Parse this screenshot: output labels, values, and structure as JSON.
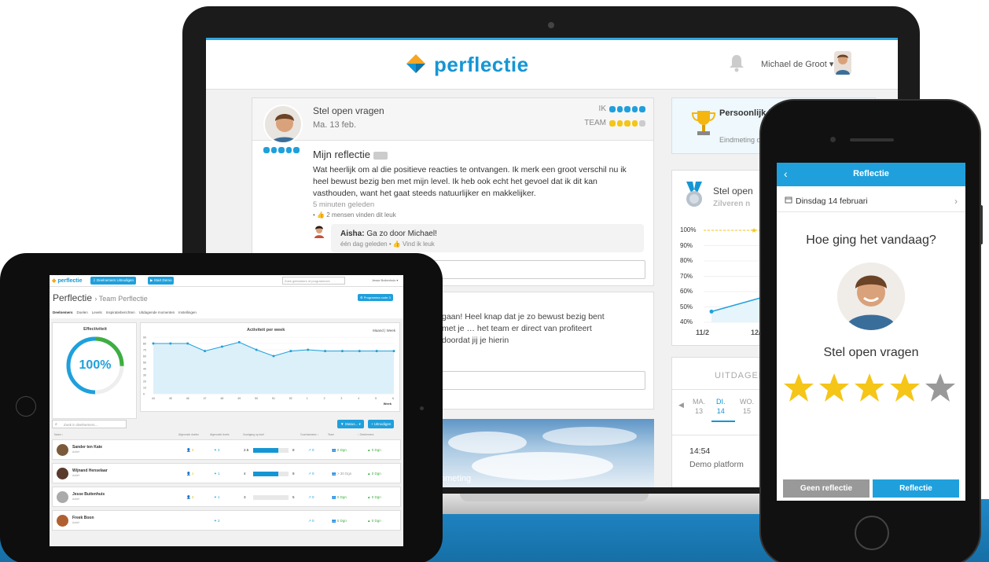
{
  "laptop": {
    "brand": "perflectie",
    "user_name": "Michael de Groot ▾",
    "post": {
      "title": "Stel open vragen",
      "date": "Ma. 13 feb.",
      "ik_label": "IK",
      "team_label": "TEAM",
      "heading": "Mijn reflectie",
      "text": "Wat heerlijk om al die positieve reacties te ontvangen. Ik merk een groot verschil nu ik heel bewust bezig ben met mijn level. Ik heb ook echt het gevoel dat ik dit kan vasthouden, want het gaat steeds natuurlijker en makkelijker.",
      "time": "5 minuten geleden",
      "likes": "• 👍 2 mensen vinden dit leuk",
      "comment_author": "Aisha:",
      "comment_text": " Ga zo door Michael!",
      "comment_meta": "één dag geleden • 👍 Vind ik leuk"
    },
    "partial_text": "gaan! Heel knap dat je zo bewust bezig bent met je … het team er direct van profiteert doordat jij je hierin",
    "photo_caption": "nmeting",
    "side1": {
      "title": "Persoonlijk leiderschap",
      "sub": "Eindmeting ov"
    },
    "side2": {
      "title": "Stel open",
      "subtitle": "Zilveren n",
      "chart_data": {
        "type": "line",
        "x": [
          "11/2",
          "12/"
        ],
        "y_ticks": [
          "100%",
          "90%",
          "80%",
          "70%",
          "60%",
          "50%",
          "40%"
        ],
        "values": [
          47,
          57
        ],
        "target": 100,
        "ylim": [
          40,
          100
        ]
      }
    },
    "side3": {
      "title": "UITDAGEN",
      "days": [
        {
          "name": "MA.",
          "num": "13"
        },
        {
          "name": "DI.",
          "num": "14"
        },
        {
          "name": "WO.",
          "num": "15"
        }
      ],
      "time": "14:54",
      "desc": "Demo platform"
    }
  },
  "tablet": {
    "brand": "perflectie",
    "btn_export": "⇩ Deelnemers Uitnodigen",
    "btn_demo": "▶ Start Demo",
    "search": "Zoek gebruikers of programma's",
    "user": "Jesse Buitenhuis ▾",
    "title": "Perflectie",
    "subtitle": "› Team Perflectie",
    "program_btn": "⚙ Programma code 3",
    "nav": [
      "Deelnemers",
      "Doelen",
      "Levels",
      "Inspiratieberichten",
      "Uitdagende momenten",
      "Instellingen"
    ],
    "eff_title": "Effectiviteit",
    "eff_value": "100%",
    "act_title": "Activiteit per week",
    "act_toggle": "Maand | Week",
    "act_xlabel": "Week",
    "chart_data": {
      "type": "line",
      "x": [
        "44",
        "45",
        "46",
        "47",
        "48",
        "49",
        "50",
        "51",
        "52",
        "1",
        "2",
        "3",
        "4",
        "5",
        "6"
      ],
      "values": [
        80,
        80,
        80,
        68,
        75,
        82,
        70,
        60,
        68,
        70,
        68,
        68,
        68,
        68,
        68
      ],
      "ylim": [
        0,
        90
      ],
      "y_ticks": [
        "90",
        "80",
        "70",
        "60",
        "50",
        "40",
        "30",
        "20",
        "10",
        "0"
      ]
    },
    "member_search": "Zoek in deelnemers...",
    "btn_status": "▼ Status... ▾",
    "btn_invite": "+ Uitnodigen",
    "headers": [
      "Naam ↕",
      "Afgeronde doelen",
      "Afgeronde levels",
      "Voortgang op doel",
      "Coachsessies ↕",
      "Team",
      "↕ Deelnemers"
    ],
    "rows": [
      {
        "name": "Sander ten Kate",
        "status": "Actief",
        "goals": "3",
        "levels": "2",
        "progress_label": "2.5",
        "progress_max": "8",
        "progress_fill": 0.7,
        "coach": "0",
        "team": "0 Dgn",
        "part": "0 Dgn"
      },
      {
        "name": "Wijnand Henselaar",
        "status": "Actief",
        "goals": "1",
        "levels": "1",
        "progress_label": "4",
        "progress_max": "8",
        "progress_fill": 0.7,
        "coach": "0",
        "team": "> 30 Dgn",
        "part": "0 Dgn"
      },
      {
        "name": "Jesse Buitenhuis",
        "status": "Actief",
        "goals": "3",
        "levels": "1",
        "progress_label": "3",
        "progress_max": "5",
        "progress_fill": 0.0,
        "coach": "0",
        "team": "0 Dgn",
        "part": "0 Dgn"
      },
      {
        "name": "Freek Boon",
        "status": "Actief",
        "goals": "",
        "levels": "2",
        "progress_label": "",
        "progress_max": "",
        "progress_fill": 0.0,
        "coach": "0",
        "team": "0 Dgn",
        "part": "0 Dgn"
      }
    ]
  },
  "phone": {
    "title": "Reflectie",
    "back": "‹",
    "date": "Dinsdag 14 februari",
    "question": "Hoe ging het vandaag?",
    "goal": "Stel open vragen",
    "rating": 4,
    "rating_max": 5,
    "btn_no": "Geen reflectie",
    "btn_yes": "Reflectie"
  },
  "colors": {
    "brand": "#1596d4",
    "accent": "#1fa0dc",
    "star": "#f5c518",
    "green": "#3fae3f",
    "band": "#1f88c7"
  }
}
